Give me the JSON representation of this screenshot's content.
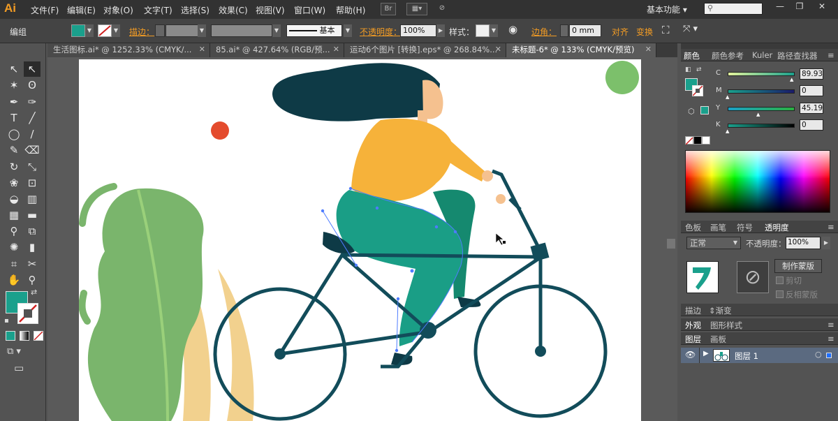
{
  "app": {
    "logo": "Ai",
    "workspace": "基本功能",
    "brand_color": "#f39c24"
  },
  "menu": [
    "文件(F)",
    "编辑(E)",
    "对象(O)",
    "文字(T)",
    "选择(S)",
    "效果(C)",
    "视图(V)",
    "窗口(W)",
    "帮助(H)"
  ],
  "menubar_icons": {
    "bridge": "Br",
    "arrange": "arrange-icon",
    "gpu": "gpu-icon"
  },
  "window_buttons": [
    "—",
    "❐",
    "✕"
  ],
  "control": {
    "selection_label": "编组",
    "fill_color": "#1aa08c",
    "stroke_label": "描边：",
    "brush_label": "基本",
    "opacity_label": "不透明度：",
    "opacity_value": "100%",
    "style_label": "样式：",
    "corner_label": "边角：",
    "corner_value": "0 mm",
    "align_label": "对齐",
    "transform_label": "变换"
  },
  "tabs": [
    {
      "label": "生活图标.ai* @ 1252.33% (CMYK/...",
      "close": "✕",
      "active": false
    },
    {
      "label": "85.ai* @ 427.64% (RGB/预...",
      "close": "✕",
      "active": false
    },
    {
      "label": "运动6个图片 [转换].eps* @ 268.84%...",
      "close": "✕",
      "active": false
    },
    {
      "label": "未标题-6* @ 133% (CMYK/预览)",
      "close": "✕",
      "active": true
    }
  ],
  "tools": [
    "selection-icon",
    "direct-selection-icon",
    "magic-wand-icon",
    "lasso-icon",
    "pen-icon",
    "curvature-icon",
    "type-icon",
    "line-icon",
    "ellipse-icon",
    "paintbrush-icon",
    "pencil-icon",
    "eraser-icon",
    "rotate-icon",
    "scale-icon",
    "warp-icon",
    "free-transform-icon",
    "shape-builder-icon",
    "chart-icon",
    "mesh-icon",
    "gradient-icon",
    "eyedropper-icon",
    "blend-icon",
    "symbol-sprayer-icon",
    "column-graph-icon",
    "artboard-icon",
    "slice-icon",
    "hand-icon",
    "zoom-icon"
  ],
  "tool_glyphs": [
    "↖",
    "↖",
    "✶",
    "ʘ",
    "✒",
    "✑",
    "T",
    "╱",
    "◯",
    "∕",
    "✎",
    "⌫",
    "↻",
    "⤡",
    "❀",
    "⊡",
    "◒",
    "▥",
    "▦",
    "▬",
    "⚲",
    "⧉",
    "✺",
    "▮",
    "⌗",
    "✂",
    "✋",
    "⚲"
  ],
  "swatches": {
    "fill": "#1aa08c",
    "stroke": "none"
  },
  "color_panel": {
    "tabs": [
      "颜色",
      "颜色参考",
      "Kuler",
      "路径查找器"
    ],
    "channels": [
      {
        "name": "C",
        "value": "89.93"
      },
      {
        "name": "M",
        "value": "0"
      },
      {
        "name": "Y",
        "value": "45.19"
      },
      {
        "name": "K",
        "value": "0"
      }
    ]
  },
  "transparency_panel": {
    "tabs": [
      "色板",
      "画笔",
      "符号",
      "透明度"
    ],
    "blend_mode": "正常",
    "opacity_label": "不透明度：",
    "opacity_value": "100%",
    "make_mask_label": "制作蒙版",
    "clip_label": "剪切",
    "invert_mask_label": "反相蒙版"
  },
  "stroke_panel": {
    "tabs": [
      "描边",
      "渐变"
    ]
  },
  "appearance_panel": {
    "tabs": [
      "外观",
      "图形样式"
    ]
  },
  "layers_panel": {
    "tabs": [
      "图层",
      "画板"
    ],
    "layer_name": "图层 1"
  },
  "art_colors": {
    "hair": "#0e3a46",
    "skin": "#f5c18f",
    "shirt": "#f6b23a",
    "pants": "#1a9e86",
    "bike": "#124c5a",
    "leaf": "#7ab56c",
    "grass": "#f2d18e",
    "red_dot": "#e44b2d",
    "green_dot": "#7cc06b"
  }
}
